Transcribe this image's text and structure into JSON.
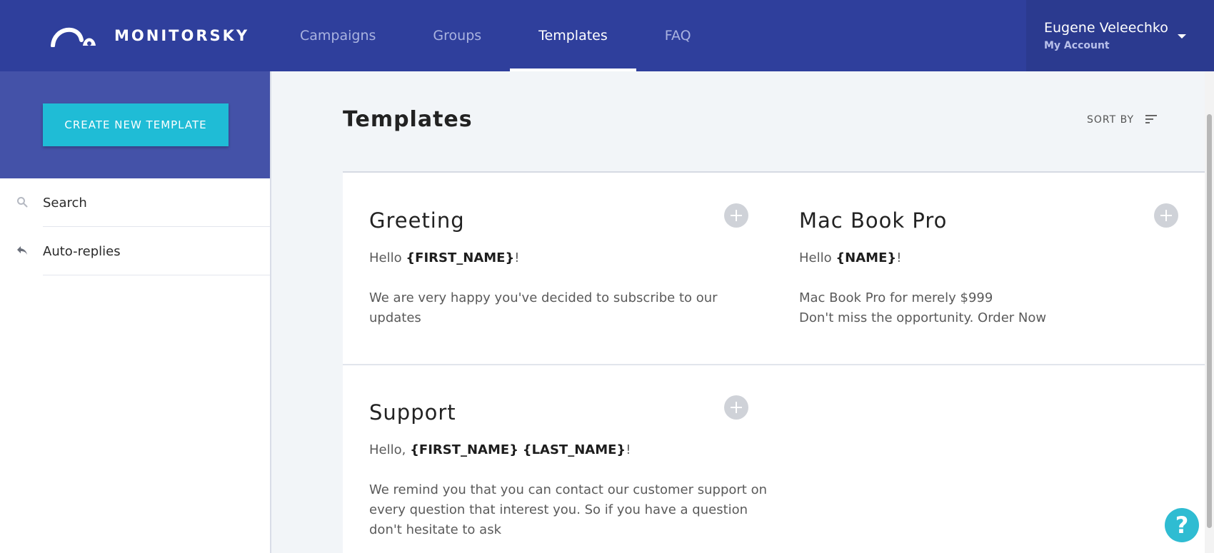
{
  "brand": {
    "name": "MONITORSKY"
  },
  "nav": {
    "items": [
      {
        "label": "Campaigns",
        "active": false
      },
      {
        "label": "Groups",
        "active": false
      },
      {
        "label": "Templates",
        "active": true
      },
      {
        "label": "FAQ",
        "active": false
      }
    ]
  },
  "account": {
    "name": "Eugene Veleechko",
    "sub": "My Account"
  },
  "sidebar": {
    "create_button": "CREATE NEW TEMPLATE",
    "items": [
      {
        "label": "Search",
        "icon": "search-icon"
      },
      {
        "label": "Auto-replies",
        "icon": "reply-icon"
      }
    ]
  },
  "main": {
    "title": "Templates",
    "sort_label": "SORT BY"
  },
  "templates": [
    {
      "title": "Greeting",
      "greeting_prefix": "Hello ",
      "var1": "{FIRST_NAME}",
      "sep": " ",
      "var2": "",
      "greeting_suffix": "!",
      "body": [
        "We are very happy you've decided to subscribe to our updates"
      ]
    },
    {
      "title": "Mac Book Pro",
      "greeting_prefix": "Hello ",
      "var1": "{NAME}",
      "sep": " ",
      "var2": "",
      "greeting_suffix": "!",
      "body": [
        "Mac Book Pro for merely $999",
        "Don't miss the opportunity. Order Now"
      ]
    },
    {
      "title": "Support",
      "greeting_prefix": "Hello, ",
      "var1": "{FIRST_NAME}",
      "sep": " ",
      "var2": "{LAST_NAME}",
      "greeting_suffix": "!",
      "body": [
        "We remind you that you can contact our customer support on",
        "every question that interest you. So if you have a question",
        "don't hesitate to ask"
      ]
    }
  ],
  "help": {
    "label": "?"
  },
  "colors": {
    "topbar": "#2f3f9c",
    "sidebar_header": "#4452a8",
    "accent": "#1fbcd6"
  }
}
